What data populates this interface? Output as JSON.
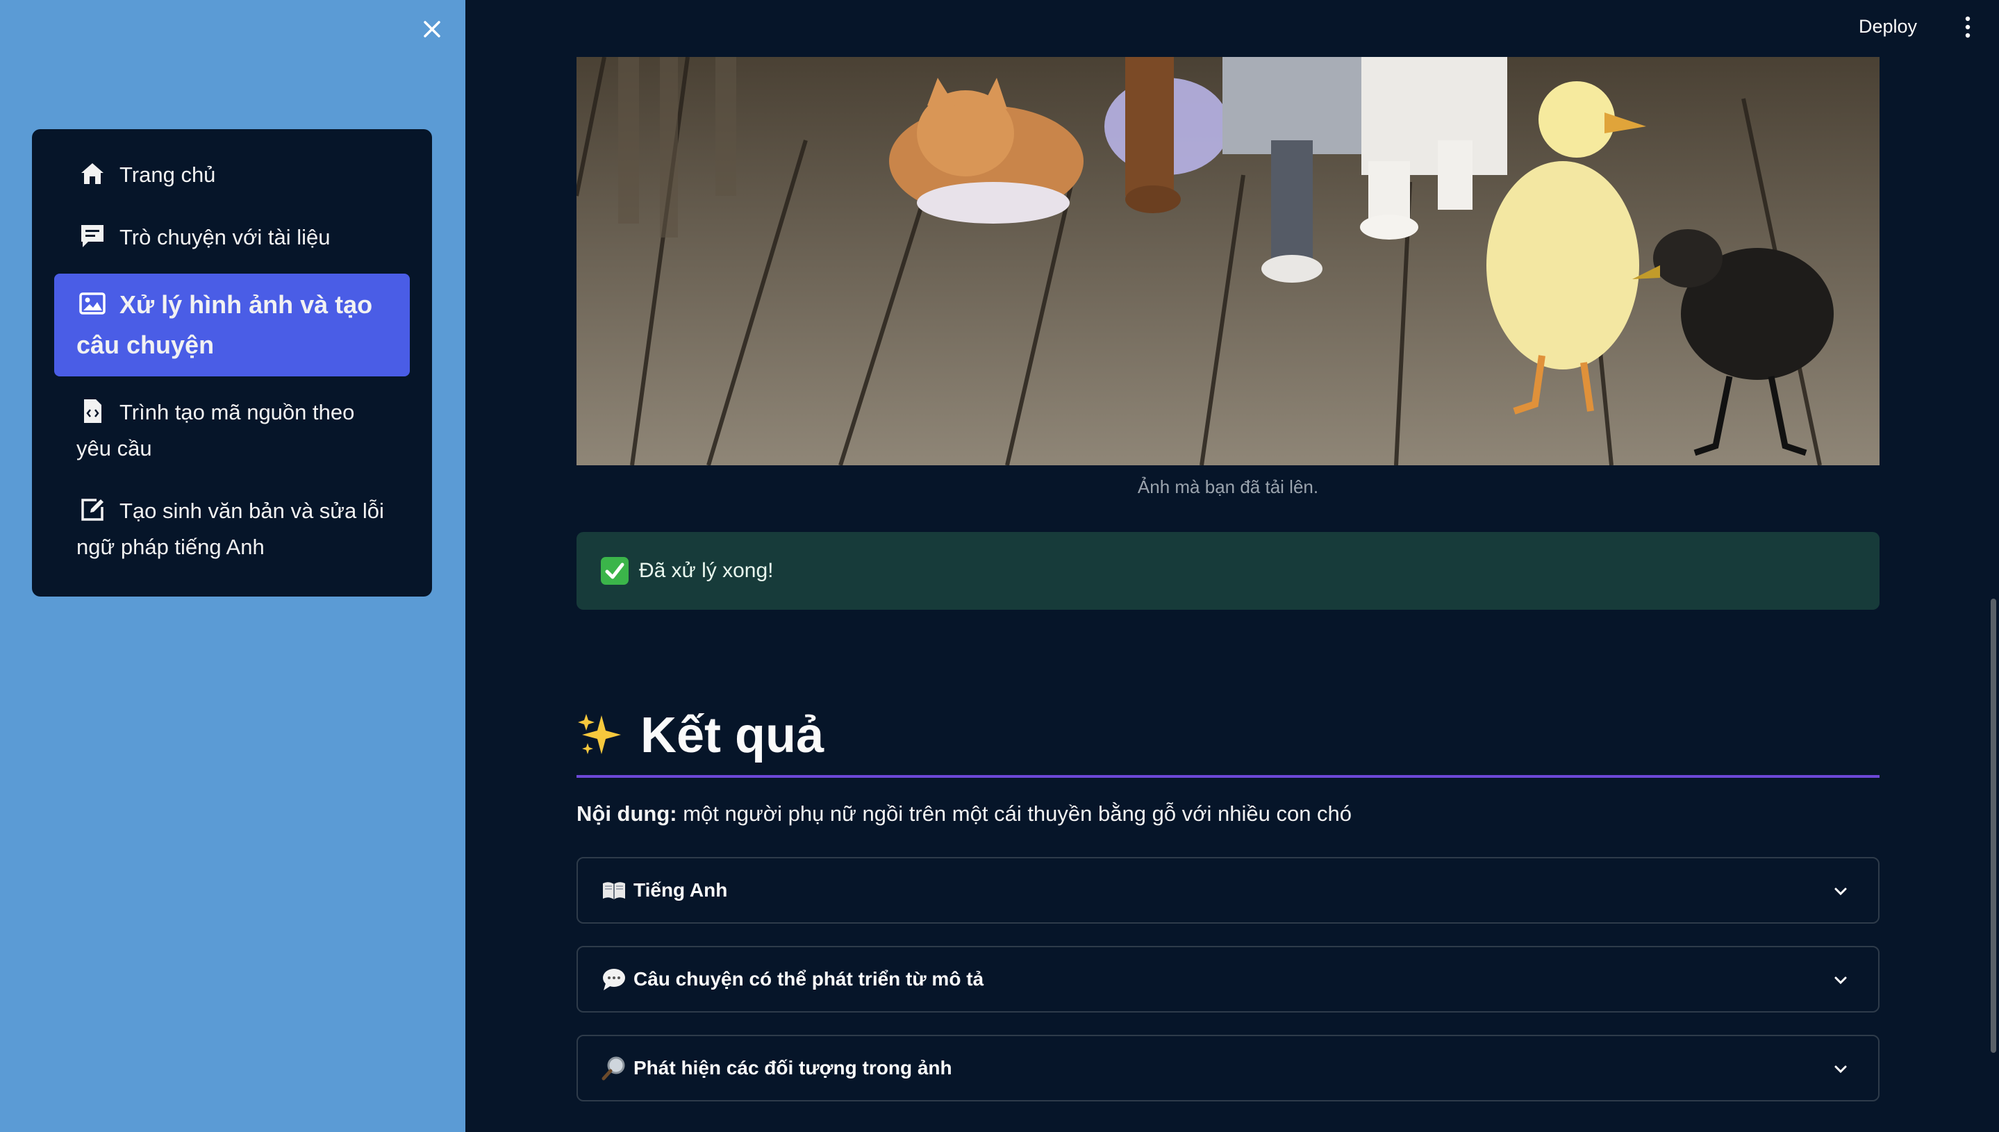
{
  "sidebar": {
    "items": [
      {
        "label": "Trang chủ",
        "icon": "home-icon",
        "active": false
      },
      {
        "label": "Trò chuyện với tài liệu",
        "icon": "chat-icon",
        "active": false
      },
      {
        "label": "Xử lý hình ảnh và tạo câu chuyện",
        "icon": "image-icon",
        "active": true
      },
      {
        "label": "Trình tạo mã nguồn theo yêu cầu",
        "icon": "code-file-icon",
        "active": false
      },
      {
        "label": "Tạo sinh văn bản và sửa lỗi ngữ pháp tiếng Anh",
        "icon": "edit-icon",
        "active": false
      }
    ],
    "colors": {
      "background": "#5b9bd5",
      "card": "#061529",
      "active": "#4a5de6"
    }
  },
  "header": {
    "deploy_label": "Deploy"
  },
  "main": {
    "image_caption": "Ảnh mà bạn đã tải lên.",
    "success_message": "Đã xử lý xong!",
    "results_title": "Kết quả",
    "content_label": "Nội dung:",
    "content_text": " một người phụ nữ ngồi trên một cái thuyền bằng gỗ với nhiều con chó",
    "expanders": [
      {
        "label": "Tiếng Anh",
        "icon": "book-icon"
      },
      {
        "label": "Câu chuyện có thể phát triển từ mô tả",
        "icon": "speech-bubble-icon"
      },
      {
        "label": "Phát hiện các đối tượng trong ảnh",
        "icon": "magnifier-icon"
      }
    ]
  },
  "theme": {
    "background": "#061529",
    "divider": "#6c48d7",
    "success_bg": "#173b3a"
  }
}
